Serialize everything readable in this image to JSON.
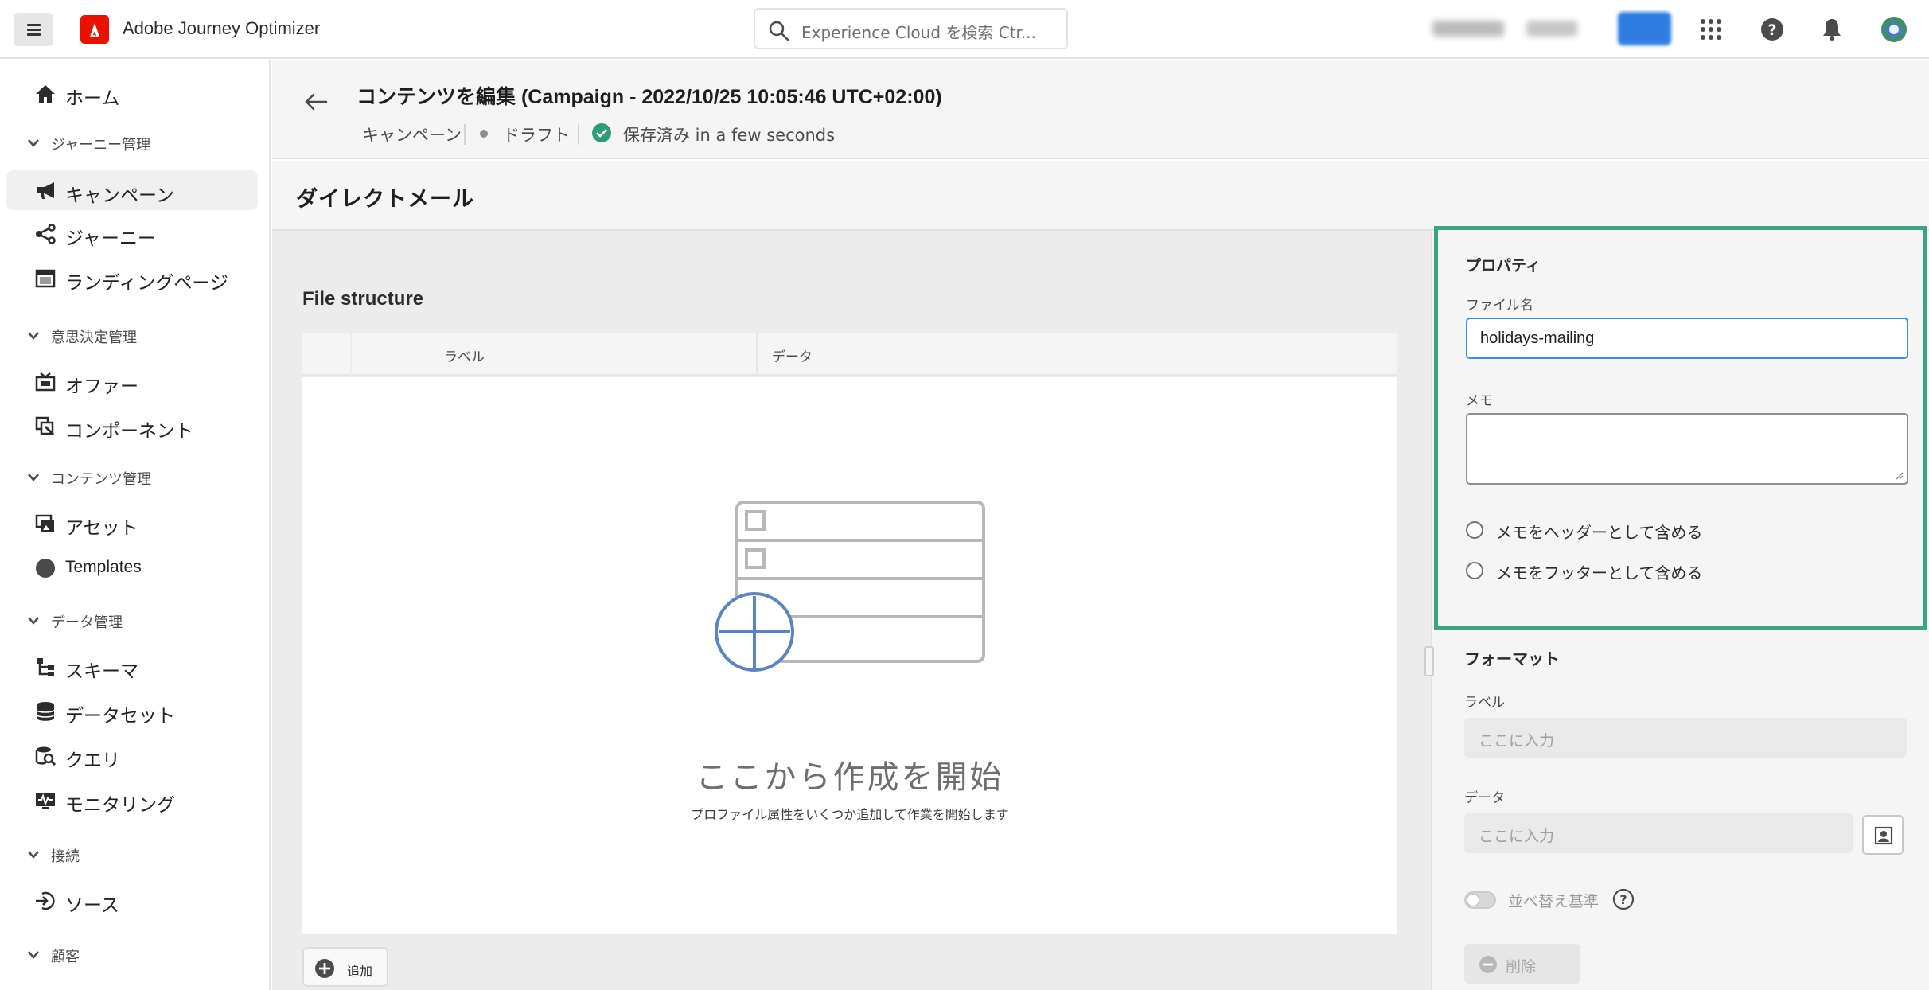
{
  "app": {
    "title": "Adobe Journey Optimizer"
  },
  "search": {
    "placeholder": "Experience Cloud を検索  Ctr..."
  },
  "sidebar": {
    "home": "ホーム",
    "group_journey": "ジャーニー管理",
    "campaigns": "キャンペーン",
    "journeys": "ジャーニー",
    "landing_pages": "ランディングページ",
    "group_decision": "意思決定管理",
    "offers": "オファー",
    "components": "コンポーネント",
    "group_content": "コンテンツ管理",
    "assets": "アセット",
    "templates": "Templates",
    "group_data": "データ管理",
    "schemas": "スキーマ",
    "datasets": "データセット",
    "queries": "クエリ",
    "monitoring": "モニタリング",
    "group_connections": "接続",
    "sources": "ソース",
    "group_customer": "顧客"
  },
  "header": {
    "title": "コンテンツを編集 (Campaign - 2022/10/25 10:05:46 UTC+02:00)",
    "breadcrumb_campaign": "キャンペーン",
    "status_draft": "ドラフト",
    "saved_text": "保存済み in a few seconds"
  },
  "section": {
    "title": "ダイレクトメール"
  },
  "file_structure": {
    "title": "File structure",
    "col_label": "ラベル",
    "col_data": "データ",
    "empty_title": "ここから作成を開始",
    "empty_subtitle": "プロファイル属性をいくつか追加して作業を開始します",
    "add_button": "追加"
  },
  "properties": {
    "title": "プロパティ",
    "filename_label": "ファイル名",
    "filename_value": "holidays-mailing",
    "memo_label": "メモ",
    "memo_header_option": "メモをヘッダーとして含める",
    "memo_footer_option": "メモをフッターとして含める"
  },
  "format": {
    "title": "フォーマット",
    "label_label": "ラベル",
    "label_placeholder": "ここに入力",
    "data_label": "データ",
    "data_placeholder": "ここに入力",
    "sort_label": "並べ替え基準",
    "delete_button": "削除"
  },
  "colors": {
    "accent": "#378ef0",
    "brand": "#eb1000",
    "highlight": "#3aa486",
    "success": "#2d9d78"
  }
}
